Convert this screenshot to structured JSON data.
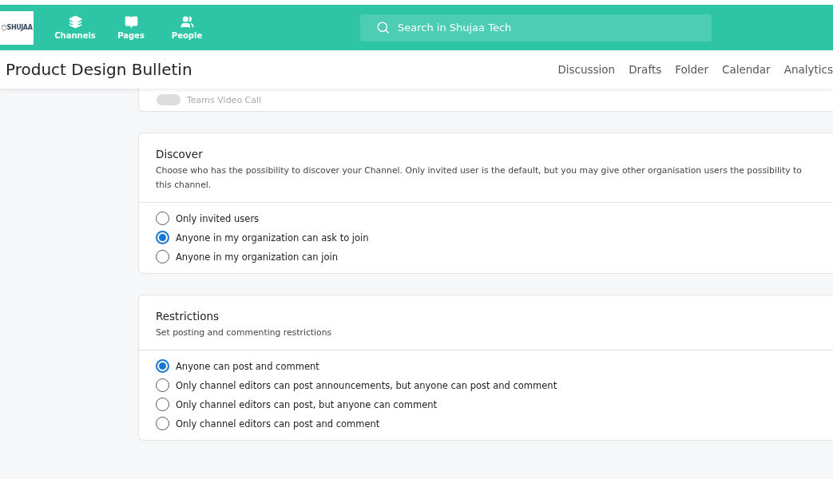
{
  "nav": {
    "logo": "SHUJAA",
    "items": [
      {
        "label": "Channels"
      },
      {
        "label": "Pages"
      },
      {
        "label": "People"
      }
    ]
  },
  "search": {
    "placeholder": "Search in Shujaa Tech"
  },
  "page": {
    "title": "Product Design Bulletin",
    "tabs": [
      "Discussion",
      "Drafts",
      "Folder",
      "Calendar",
      "Analytics"
    ]
  },
  "video_call": {
    "label": "Teams Video Call",
    "on": false
  },
  "sections": [
    {
      "title": "Discover",
      "description": [
        "Choose who has the possibility to discover your Channel. Only invited user is the default, but you may give other organisation users the possibility to",
        "this channel."
      ],
      "options": [
        {
          "label": "Only invited users",
          "selected": false
        },
        {
          "label": "Anyone in my organization can ask to join",
          "selected": true
        },
        {
          "label": "Anyone in my organization can join",
          "selected": false
        }
      ]
    },
    {
      "title": "Restrictions",
      "description": [
        "Set posting and commenting restrictions"
      ],
      "options": [
        {
          "label": "Anyone can post and comment",
          "selected": true
        },
        {
          "label": "Only channel editors can post announcements, but anyone can post and comment",
          "selected": false
        },
        {
          "label": "Only channel editors can post, but anyone can comment",
          "selected": false
        },
        {
          "label": "Only channel editors can post and comment",
          "selected": false
        }
      ]
    }
  ]
}
